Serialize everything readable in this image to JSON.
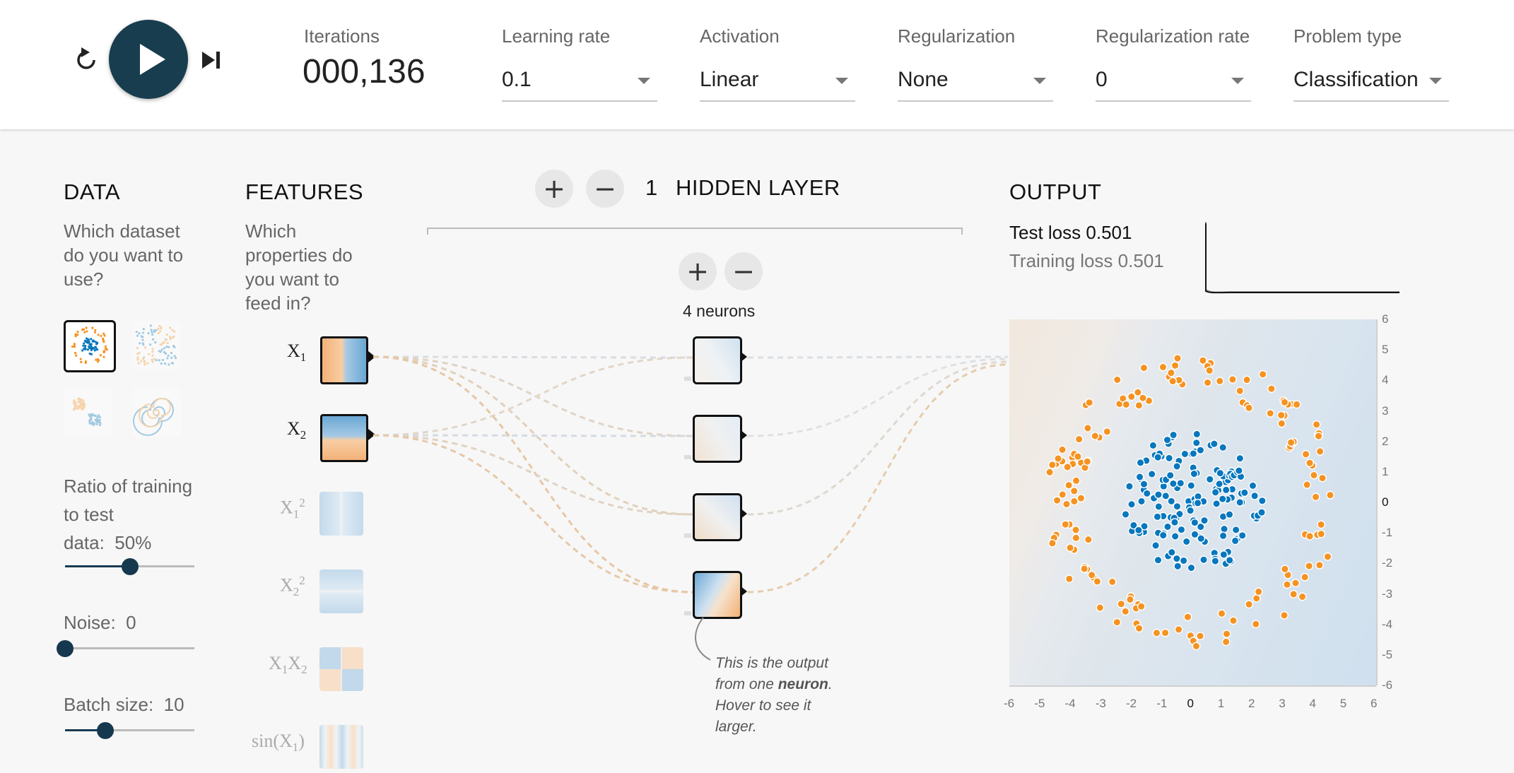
{
  "controls": {
    "reset_icon": "reset-icon",
    "play_icon": "play-icon",
    "step_icon": "step-icon",
    "iterations_label": "Iterations",
    "iterations_value": "000,136",
    "learning_rate_label": "Learning rate",
    "learning_rate_value": "0.1",
    "activation_label": "Activation",
    "activation_value": "Linear",
    "regularization_label": "Regularization",
    "regularization_value": "None",
    "regularization_rate_label": "Regularization rate",
    "regularization_rate_value": "0",
    "problem_type_label": "Problem type",
    "problem_type_value": "Classification"
  },
  "data_panel": {
    "title": "DATA",
    "description": [
      "Which dataset",
      "do you want to",
      "use?"
    ],
    "ratio_label": [
      "Ratio of training",
      "to test",
      "data:"
    ],
    "ratio_value": "50%",
    "ratio_level": 0.5,
    "noise_label": "Noise:",
    "noise_value": "0",
    "noise_level": 0.0,
    "batch_label": "Batch size:",
    "batch_value": "10",
    "batch_level": 0.31
  },
  "features_panel": {
    "title": "FEATURES",
    "description": [
      "Which",
      "properties do",
      "you want to",
      "feed in?"
    ],
    "features": [
      {
        "base": "X",
        "sub": "1",
        "sup": ""
      },
      {
        "base": "X",
        "sub": "2",
        "sup": ""
      },
      {
        "base": "X",
        "sub": "1",
        "sup": "2"
      },
      {
        "base": "X",
        "sub": "2",
        "sup": "2"
      },
      {
        "base": "X",
        "sub": "1",
        "base2": "X",
        "sub2": "2"
      },
      {
        "base": "sin(X",
        "sub": "1",
        "close": ")"
      }
    ]
  },
  "network": {
    "layer_count": "1",
    "layer_label": "HIDDEN LAYER",
    "neurons_label": "4 neurons",
    "note_line1": "This is the output",
    "note_line2_pre": "from one ",
    "note_line2_bold": "neuron",
    "note_line2_post": ".",
    "note_line3": "Hover to see it",
    "note_line4": "larger."
  },
  "output": {
    "title": "OUTPUT",
    "test_loss_label": "Test loss",
    "test_loss_value": "0.501",
    "training_loss_label": "Training loss",
    "training_loss_value": "0.501",
    "x_ticks": [
      "-6",
      "-5",
      "-4",
      "-3",
      "-2",
      "-1",
      "0",
      "1",
      "2",
      "3",
      "4",
      "5",
      "6"
    ],
    "y_ticks": [
      "6",
      "5",
      "4",
      "3",
      "2",
      "1",
      "0",
      "-1",
      "-2",
      "-3",
      "-4",
      "-5",
      "-6"
    ]
  },
  "colors": {
    "positive": "#0877bd",
    "negative": "#f59322",
    "accent": "#183d4e"
  }
}
